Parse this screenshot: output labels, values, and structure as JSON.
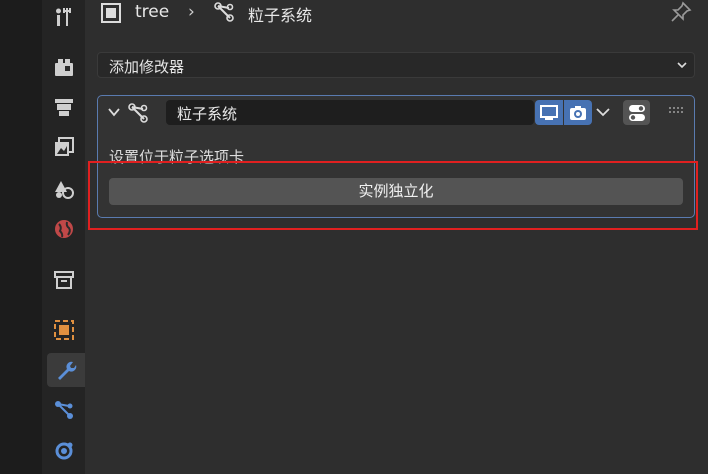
{
  "header": {
    "object_name": "tree",
    "separator": "›",
    "particle_system_name": "粒子系统"
  },
  "add_modifier": {
    "label": "添加修改器"
  },
  "modifier": {
    "name": "粒子系统",
    "info_text": "设置位于粒子选项卡",
    "apply_button_label": "实例独立化"
  },
  "sidebar": {
    "tabs": [
      {
        "name": "tool-icon"
      },
      {
        "name": "render-icon"
      },
      {
        "name": "output-icon"
      },
      {
        "name": "view-layer-icon"
      },
      {
        "name": "scene-icon"
      },
      {
        "name": "world-icon"
      },
      {
        "name": "collection-icon"
      },
      {
        "name": "object-icon"
      },
      {
        "name": "modifier-wrench-icon",
        "active": true
      },
      {
        "name": "particles-icon"
      },
      {
        "name": "physics-icon"
      }
    ]
  },
  "colors": {
    "accent_blue": "#4772b3",
    "highlight_red": "#e02020",
    "object_orange": "#e09040",
    "world_red": "#c04848"
  }
}
